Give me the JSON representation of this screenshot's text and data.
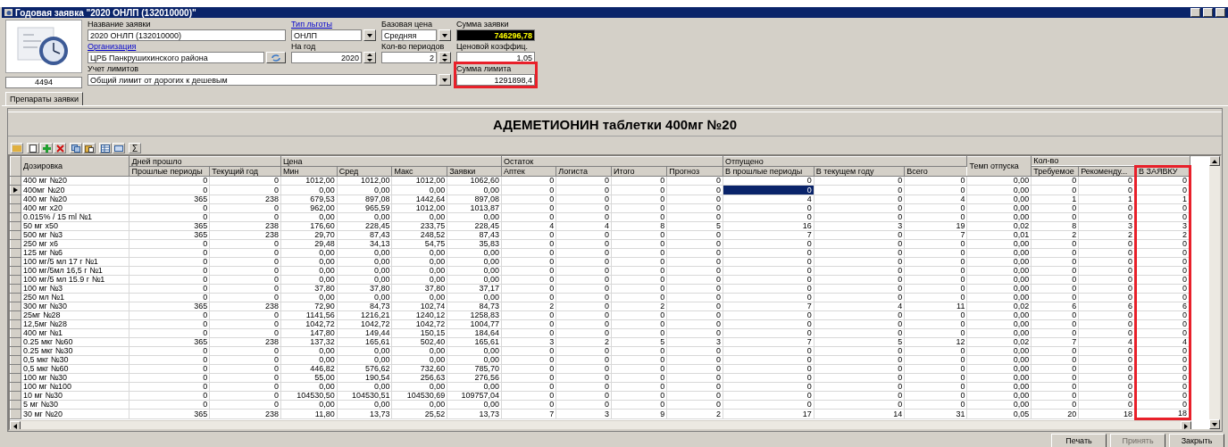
{
  "window": {
    "title": "Годовая заявка \"2020 ОНЛП (132010000)\""
  },
  "record_id": "4494",
  "form_rows": [
    [
      {
        "kind": "text",
        "label": "Название заявки",
        "link": false,
        "value": "2020 ОНЛП (132010000)",
        "highlighted": false
      },
      {
        "kind": "select",
        "label": "Тип льготы",
        "link": true,
        "value": "ОНЛП",
        "highlighted": false
      },
      {
        "kind": "select",
        "label": "Базовая цена",
        "link": false,
        "value": "Средняя",
        "highlighted": false
      },
      {
        "kind": "total",
        "label": "Сумма заявки",
        "link": false,
        "value": "746296,78",
        "highlighted": false
      }
    ],
    [
      {
        "kind": "lookup",
        "label": "Организация",
        "link": true,
        "value": "ЦРБ Панкрушихинского района",
        "highlighted": false
      },
      {
        "kind": "spin",
        "label": "На год",
        "link": false,
        "value": "2020",
        "highlighted": false
      },
      {
        "kind": "spin",
        "label": "Кол-во периодов",
        "link": false,
        "value": "2",
        "highlighted": false
      },
      {
        "kind": "number",
        "label": "Ценовой коэффиц.",
        "link": false,
        "value": "1,05",
        "highlighted": false
      }
    ],
    [
      {
        "kind": "select",
        "label": "Учет лимитов",
        "link": false,
        "value": "Общий лимит от дорогих к дешевым",
        "highlighted": false
      },
      {
        "kind": "number",
        "label": "Сумма лимита",
        "link": false,
        "value": "1291898,4",
        "highlighted": true
      }
    ]
  ],
  "tabs": [
    {
      "label": "Препараты заявки",
      "selected": true
    }
  ],
  "drug_title": "АДЕМЕТИОНИН таблетки 400мг №20",
  "toolbar": {
    "sum_label": "Σ"
  },
  "table": {
    "groups": [
      {
        "label": "Дозировка",
        "focused": false,
        "highlighted": false
      },
      {
        "label": "Дней прошло",
        "columns": [
          {
            "label": "Прошлые периоды",
            "focused": false,
            "highlighted": false
          },
          {
            "label": "Текущий год",
            "focused": false,
            "highlighted": false
          }
        ]
      },
      {
        "label": "Цена",
        "columns": [
          {
            "label": "Мин",
            "focused": false,
            "highlighted": false
          },
          {
            "label": "Сред",
            "focused": false,
            "highlighted": false
          },
          {
            "label": "Макс",
            "focused": false,
            "highlighted": false
          },
          {
            "label": "Заявки",
            "focused": false,
            "highlighted": false
          }
        ]
      },
      {
        "label": "Остаток",
        "columns": [
          {
            "label": "Аптек",
            "focused": false,
            "highlighted": false
          },
          {
            "label": "Логиста",
            "focused": false,
            "highlighted": false
          },
          {
            "label": "Итого",
            "focused": false,
            "highlighted": false
          },
          {
            "label": "Прогноз",
            "focused": false,
            "highlighted": false
          }
        ]
      },
      {
        "label": "Отпущено",
        "columns": [
          {
            "label": "В прошлые периоды",
            "focused": true,
            "highlighted": false
          },
          {
            "label": "В текущем году",
            "focused": false,
            "highlighted": false
          },
          {
            "label": "Всего",
            "focused": false,
            "highlighted": false
          }
        ]
      },
      {
        "label": "Темп отпуска",
        "focused": false,
        "highlighted": false
      },
      {
        "label": "Кол-во",
        "columns": [
          {
            "label": "Требуемое",
            "focused": false,
            "highlighted": false
          },
          {
            "label": "Рекоменду...",
            "focused": false,
            "highlighted": false
          },
          {
            "label": "В ЗАЯВКУ",
            "focused": false,
            "highlighted": true
          }
        ]
      }
    ],
    "rows": [
      {
        "selected": false,
        "cells": [
          "400 мг №20",
          "0",
          "0",
          "1012,00",
          "1012,00",
          "1012,00",
          "1062,60",
          "0",
          "0",
          "0",
          "0",
          "0",
          "0",
          "0",
          "0,00",
          "0",
          "0",
          "0"
        ]
      },
      {
        "selected": true,
        "cells": [
          "400мг №20",
          "0",
          "0",
          "0,00",
          "0,00",
          "0,00",
          "0,00",
          "0",
          "0",
          "0",
          "0",
          "0",
          "0",
          "0",
          "0,00",
          "0",
          "0",
          "0"
        ]
      },
      {
        "selected": false,
        "cells": [
          "400 мг №20",
          "365",
          "238",
          "679,53",
          "897,08",
          "1442,64",
          "897,08",
          "0",
          "0",
          "0",
          "0",
          "4",
          "0",
          "4",
          "0,00",
          "1",
          "1",
          "1"
        ]
      },
      {
        "selected": false,
        "cells": [
          "400 мг х20",
          "0",
          "0",
          "962,00",
          "965,59",
          "1012,00",
          "1013,87",
          "0",
          "0",
          "0",
          "0",
          "0",
          "0",
          "0",
          "0,00",
          "0",
          "0",
          "0"
        ]
      },
      {
        "selected": false,
        "cells": [
          "0.015% / 15 ml №1",
          "0",
          "0",
          "0,00",
          "0,00",
          "0,00",
          "0,00",
          "0",
          "0",
          "0",
          "0",
          "0",
          "0",
          "0",
          "0,00",
          "0",
          "0",
          "0"
        ]
      },
      {
        "selected": false,
        "cells": [
          "50 мг х50",
          "365",
          "238",
          "176,60",
          "228,45",
          "233,75",
          "228,45",
          "4",
          "4",
          "8",
          "5",
          "16",
          "3",
          "19",
          "0,02",
          "8",
          "3",
          "3"
        ]
      },
      {
        "selected": false,
        "cells": [
          "500 мг №3",
          "365",
          "238",
          "29,70",
          "87,43",
          "248,52",
          "87,43",
          "0",
          "0",
          "0",
          "0",
          "7",
          "0",
          "7",
          "0,01",
          "2",
          "2",
          "2"
        ]
      },
      {
        "selected": false,
        "cells": [
          "250 мг х6",
          "0",
          "0",
          "29,48",
          "34,13",
          "54,75",
          "35,83",
          "0",
          "0",
          "0",
          "0",
          "0",
          "0",
          "0",
          "0,00",
          "0",
          "0",
          "0"
        ]
      },
      {
        "selected": false,
        "cells": [
          "125 мг №6",
          "0",
          "0",
          "0,00",
          "0,00",
          "0,00",
          "0,00",
          "0",
          "0",
          "0",
          "0",
          "0",
          "0",
          "0",
          "0,00",
          "0",
          "0",
          "0"
        ]
      },
      {
        "selected": false,
        "cells": [
          "100 мг/5 мл 17 г №1",
          "0",
          "0",
          "0,00",
          "0,00",
          "0,00",
          "0,00",
          "0",
          "0",
          "0",
          "0",
          "0",
          "0",
          "0",
          "0,00",
          "0",
          "0",
          "0"
        ]
      },
      {
        "selected": false,
        "cells": [
          "100 мг/5мл 16,5 г №1",
          "0",
          "0",
          "0,00",
          "0,00",
          "0,00",
          "0,00",
          "0",
          "0",
          "0",
          "0",
          "0",
          "0",
          "0",
          "0,00",
          "0",
          "0",
          "0"
        ]
      },
      {
        "selected": false,
        "cells": [
          "100 мг/5 мл 15.9 г №1",
          "0",
          "0",
          "0,00",
          "0,00",
          "0,00",
          "0,00",
          "0",
          "0",
          "0",
          "0",
          "0",
          "0",
          "0",
          "0,00",
          "0",
          "0",
          "0"
        ]
      },
      {
        "selected": false,
        "cells": [
          "100 мг №3",
          "0",
          "0",
          "37,80",
          "37,80",
          "37,80",
          "37,17",
          "0",
          "0",
          "0",
          "0",
          "0",
          "0",
          "0",
          "0,00",
          "0",
          "0",
          "0"
        ]
      },
      {
        "selected": false,
        "cells": [
          "250 мл №1",
          "0",
          "0",
          "0,00",
          "0,00",
          "0,00",
          "0,00",
          "0",
          "0",
          "0",
          "0",
          "0",
          "0",
          "0",
          "0,00",
          "0",
          "0",
          "0"
        ]
      },
      {
        "selected": false,
        "cells": [
          "300 мг №30",
          "365",
          "238",
          "72,90",
          "84,73",
          "102,74",
          "84,73",
          "2",
          "0",
          "2",
          "0",
          "7",
          "4",
          "11",
          "0,02",
          "6",
          "6",
          "6"
        ]
      },
      {
        "selected": false,
        "cells": [
          "25мг №28",
          "0",
          "0",
          "1141,56",
          "1216,21",
          "1240,12",
          "1258,83",
          "0",
          "0",
          "0",
          "0",
          "0",
          "0",
          "0",
          "0,00",
          "0",
          "0",
          "0"
        ]
      },
      {
        "selected": false,
        "cells": [
          "12,5мг №28",
          "0",
          "0",
          "1042,72",
          "1042,72",
          "1042,72",
          "1004,77",
          "0",
          "0",
          "0",
          "0",
          "0",
          "0",
          "0",
          "0,00",
          "0",
          "0",
          "0"
        ]
      },
      {
        "selected": false,
        "cells": [
          "400 мг №1",
          "0",
          "0",
          "147,80",
          "149,44",
          "150,15",
          "184,64",
          "0",
          "0",
          "0",
          "0",
          "0",
          "0",
          "0",
          "0,00",
          "0",
          "0",
          "0"
        ]
      },
      {
        "selected": false,
        "cells": [
          "0.25 мкг №60",
          "365",
          "238",
          "137,32",
          "165,61",
          "502,40",
          "165,61",
          "3",
          "2",
          "5",
          "3",
          "7",
          "5",
          "12",
          "0,02",
          "7",
          "4",
          "4"
        ]
      },
      {
        "selected": false,
        "cells": [
          "0.25 мкг №30",
          "0",
          "0",
          "0,00",
          "0,00",
          "0,00",
          "0,00",
          "0",
          "0",
          "0",
          "0",
          "0",
          "0",
          "0",
          "0,00",
          "0",
          "0",
          "0"
        ]
      },
      {
        "selected": false,
        "cells": [
          "0,5 мкг №30",
          "0",
          "0",
          "0,00",
          "0,00",
          "0,00",
          "0,00",
          "0",
          "0",
          "0",
          "0",
          "0",
          "0",
          "0",
          "0,00",
          "0",
          "0",
          "0"
        ]
      },
      {
        "selected": false,
        "cells": [
          "0,5 мкг №60",
          "0",
          "0",
          "446,82",
          "576,62",
          "732,60",
          "785,70",
          "0",
          "0",
          "0",
          "0",
          "0",
          "0",
          "0",
          "0,00",
          "0",
          "0",
          "0"
        ]
      },
      {
        "selected": false,
        "cells": [
          "100 мг №30",
          "0",
          "0",
          "55,00",
          "190,54",
          "256,63",
          "276,56",
          "0",
          "0",
          "0",
          "0",
          "0",
          "0",
          "0",
          "0,00",
          "0",
          "0",
          "0"
        ]
      },
      {
        "selected": false,
        "cells": [
          "100 мг №100",
          "0",
          "0",
          "0,00",
          "0,00",
          "0,00",
          "0,00",
          "0",
          "0",
          "0",
          "0",
          "0",
          "0",
          "0",
          "0,00",
          "0",
          "0",
          "0"
        ]
      },
      {
        "selected": false,
        "cells": [
          "10 мг №30",
          "0",
          "0",
          "104530,50",
          "104530,51",
          "104530,69",
          "109757,04",
          "0",
          "0",
          "0",
          "0",
          "0",
          "0",
          "0",
          "0,00",
          "0",
          "0",
          "0"
        ]
      },
      {
        "selected": false,
        "cells": [
          "5 мг №30",
          "0",
          "0",
          "0,00",
          "0,00",
          "0,00",
          "0,00",
          "0",
          "0",
          "0",
          "0",
          "0",
          "0",
          "0",
          "0,00",
          "0",
          "0",
          "0"
        ]
      },
      {
        "selected": false,
        "cells": [
          "30 мг №20",
          "365",
          "238",
          "11,80",
          "13,73",
          "25,52",
          "13,73",
          "7",
          "3",
          "9",
          "2",
          "17",
          "14",
          "31",
          "0,05",
          "20",
          "18",
          "18"
        ]
      }
    ]
  },
  "buttons": [
    {
      "label": "Печать",
      "disabled": false
    },
    {
      "label": "Принять",
      "disabled": true
    },
    {
      "label": "Закрыть",
      "disabled": false
    }
  ]
}
